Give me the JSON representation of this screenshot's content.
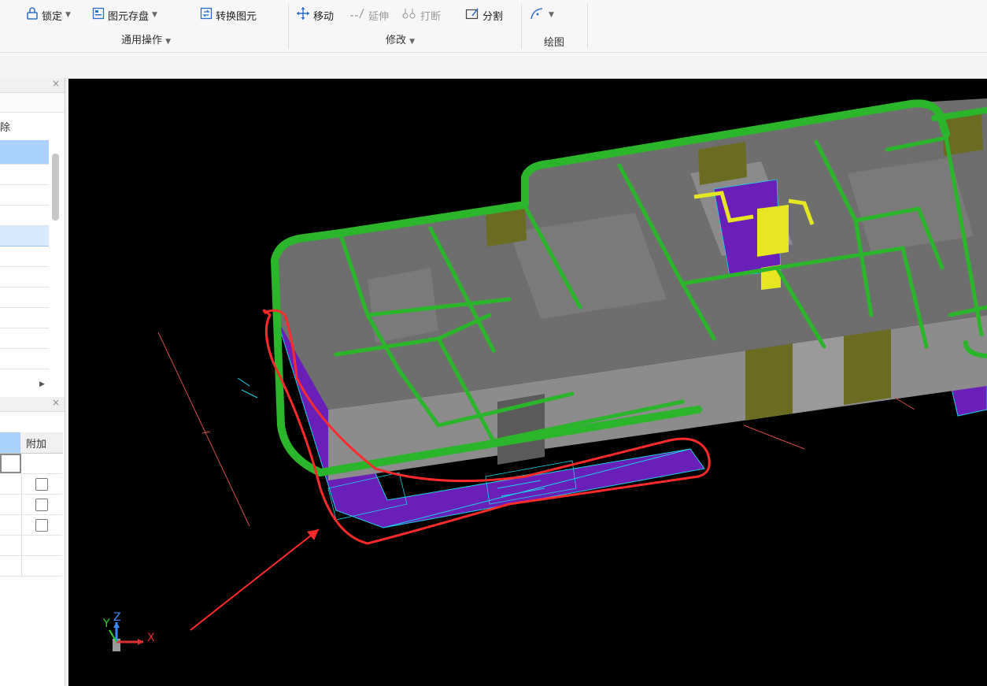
{
  "ribbon": {
    "lock": "锁定",
    "save_elements": "图元存盘",
    "convert_elements": "转换图元",
    "general_ops": "通用操作",
    "move": "移动",
    "extend": "延伸",
    "break": "打断",
    "split": "分割",
    "modify": "修改",
    "draw": "绘图"
  },
  "left_panel": {
    "partial_text": "除",
    "grid_header": "附加"
  },
  "viewport": {
    "axis_x": "X",
    "axis_y": "Y",
    "axis_z": "Z"
  },
  "colors": {
    "beam_green": "#2bb52b",
    "slab_gray": "#6e6e6e",
    "wall_gray": "#8c8c8c",
    "foundation_purple": "#6a1fb8",
    "cyan_dim": "#1ad3e6",
    "highlight_red": "#ff2a2a",
    "yellow": "#e6e622"
  }
}
